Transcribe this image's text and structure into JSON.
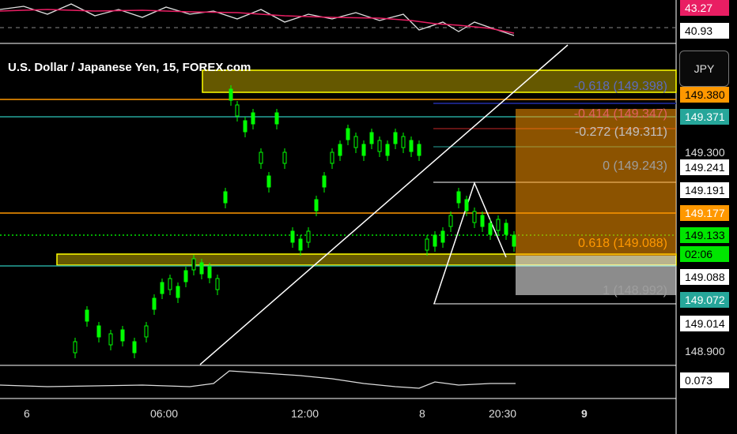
{
  "title": "U.S. Dollar / Japanese Yen, 15, FOREX.com",
  "currency_button": "JPY",
  "rsi_labels": [
    {
      "text": "43.27",
      "bg": "#e91e63",
      "color": "#ffffff"
    },
    {
      "text": "40.93",
      "bg": "#ffffff",
      "color": "#000000"
    }
  ],
  "price_labels": [
    {
      "text": "149.380",
      "bg": "#ff9800",
      "color": "#000000"
    },
    {
      "text": "149.371",
      "bg": "#26a69a",
      "color": "#ffffff"
    },
    {
      "text": "149.300",
      "bg": "",
      "color": "#dddddd"
    },
    {
      "text": "149.241",
      "bg": "#ffffff",
      "color": "#000000"
    },
    {
      "text": "149.191",
      "bg": "#ffffff",
      "color": "#000000"
    },
    {
      "text": "149.177",
      "bg": "#ff9800",
      "color": "#ffffff"
    },
    {
      "text": "149.133",
      "bg": "#00e600",
      "color": "#000000"
    },
    {
      "text": "02:06",
      "bg": "#00e600",
      "color": "#000000"
    },
    {
      "text": "149.088",
      "bg": "#ffffff",
      "color": "#000000"
    },
    {
      "text": "149.072",
      "bg": "#26a69a",
      "color": "#ffffff"
    },
    {
      "text": "149.014",
      "bg": "#ffffff",
      "color": "#000000"
    },
    {
      "text": "148.900",
      "bg": "",
      "color": "#dddddd"
    }
  ],
  "oscillator_label": "0.073",
  "fib_labels": [
    {
      "text": "-0.618 (149.398)",
      "color": "#5c6bc0"
    },
    {
      "text": "-0.414 (149.347)",
      "color": "#e06060"
    },
    {
      "text": "-0.272 (149.311)",
      "color": "#c0c0c0"
    },
    {
      "text": "0 (149.243)",
      "color": "#9e9e9e"
    },
    {
      "text": "0.618 (149.088)",
      "color": "#ff9800"
    },
    {
      "text": "1 (148.992)",
      "color": "#9e9e9e"
    }
  ],
  "x_labels": [
    "6",
    "06:00",
    "12:00",
    "8",
    "20:30",
    "9"
  ],
  "colors": {
    "bull": "#00ff00",
    "zone": "#ffff00",
    "orange": "#ff9800",
    "teal": "#26a69a",
    "navy": "#1a237e",
    "rsi": "#e91e63"
  }
}
